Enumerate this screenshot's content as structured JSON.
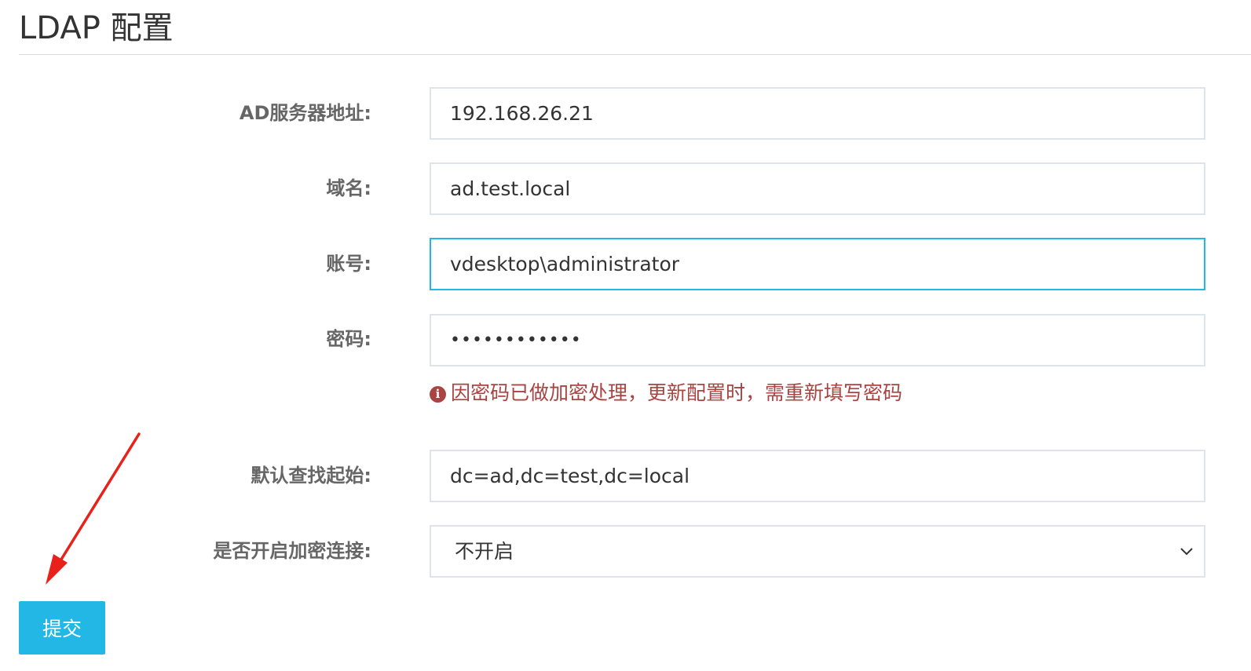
{
  "page": {
    "title": "LDAP 配置"
  },
  "form": {
    "server": {
      "label": "AD服务器地址:",
      "value": "192.168.26.21"
    },
    "domain": {
      "label": "域名:",
      "value": "ad.test.local"
    },
    "account": {
      "label": "账号:",
      "value": "vdesktop\\administrator"
    },
    "password": {
      "label": "密码:",
      "value": "••••••••••••"
    },
    "password_help": {
      "icon": "info-icon",
      "text": "因密码已做加密处理，更新配置时，需重新填写密码"
    },
    "base_dn": {
      "label": "默认查找起始:",
      "value": "dc=ad,dc=test,dc=local"
    },
    "encryption": {
      "label": "是否开启加密连接:",
      "selected": "不开启"
    },
    "submit_label": "提交"
  },
  "colors": {
    "accent": "#23b7e5",
    "error": "#a94442",
    "annotation": "#e8211b"
  }
}
